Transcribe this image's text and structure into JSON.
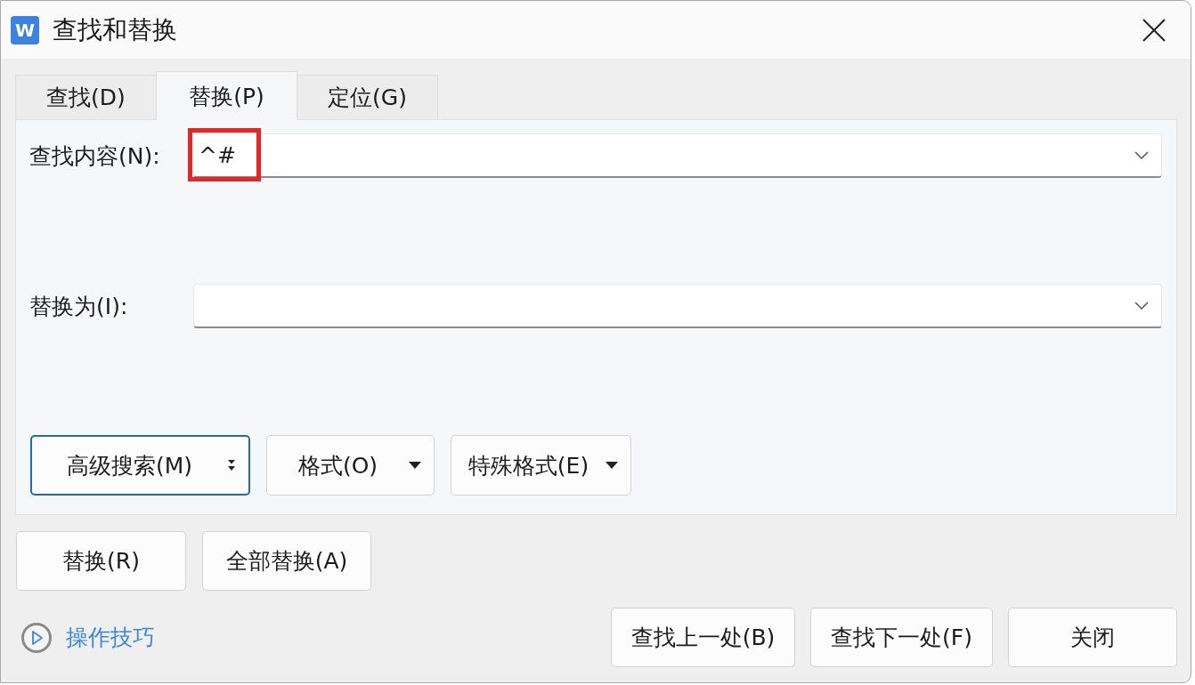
{
  "window": {
    "logo_letter": "W",
    "title": "查找和替换"
  },
  "tabs": [
    {
      "label": "查找(D)",
      "selected": false
    },
    {
      "label": "替换(P)",
      "selected": true
    },
    {
      "label": "定位(G)",
      "selected": false
    }
  ],
  "find": {
    "label": "查找内容(N):",
    "value": "^#",
    "highlighted": true
  },
  "replace": {
    "label": "替换为(I):"
  },
  "option_buttons": [
    {
      "label": "高级搜索(M)",
      "kind": "expander",
      "focused": true
    },
    {
      "label": "格式(O)",
      "kind": "dropdown",
      "focused": false
    },
    {
      "label": "特殊格式(E)",
      "kind": "dropdown",
      "focused": false
    }
  ],
  "replace_buttons": [
    "替换(R)",
    "全部替换(A)"
  ],
  "tips_link": "操作技巧",
  "nav_buttons": [
    "查找上一处(B)",
    "查找下一处(F)",
    "关闭"
  ]
}
